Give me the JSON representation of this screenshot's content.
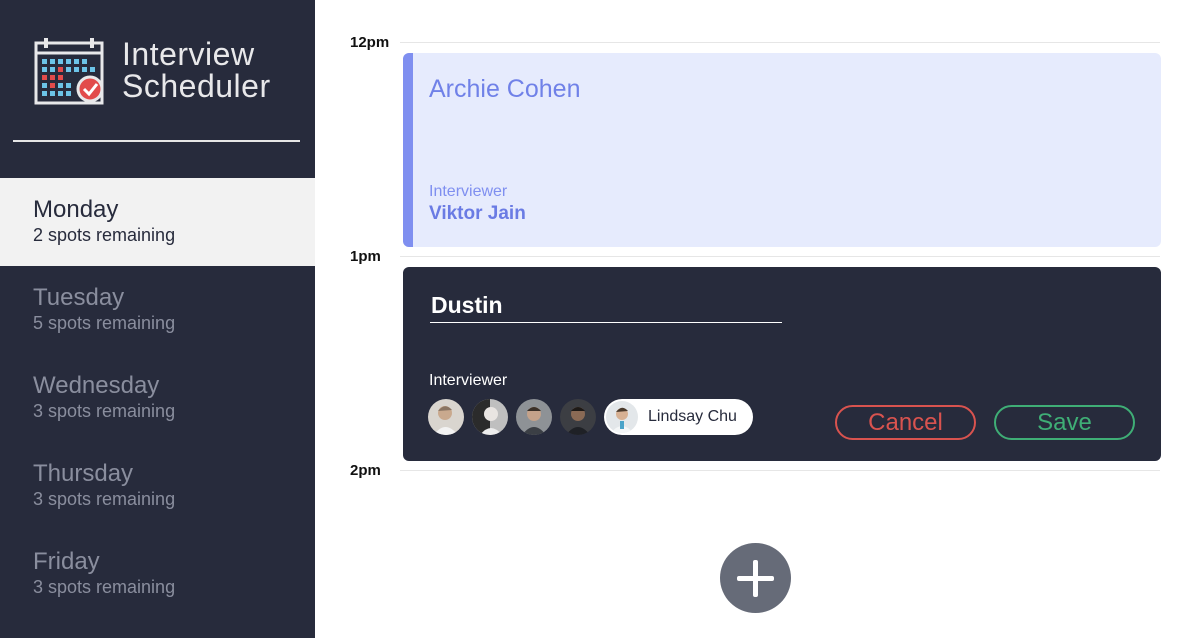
{
  "app": {
    "title_line1": "Interview",
    "title_line2": "Scheduler"
  },
  "days": [
    {
      "name": "Monday",
      "spots": "2 spots remaining",
      "selected": true
    },
    {
      "name": "Tuesday",
      "spots": "5 spots remaining",
      "selected": false
    },
    {
      "name": "Wednesday",
      "spots": "3 spots remaining",
      "selected": false
    },
    {
      "name": "Thursday",
      "spots": "3 spots remaining",
      "selected": false
    },
    {
      "name": "Friday",
      "spots": "3 spots remaining",
      "selected": false
    }
  ],
  "schedule": {
    "hours": [
      "12pm",
      "1pm",
      "2pm"
    ],
    "appointment": {
      "student": "Archie Cohen",
      "interviewer_label": "Interviewer",
      "interviewer": "Viktor Jain"
    },
    "form": {
      "student_value": "Dustin",
      "interviewer_label": "Interviewer",
      "selected_interviewer": "Lindsay Chu",
      "cancel_label": "Cancel",
      "save_label": "Save"
    }
  },
  "colors": {
    "sidebar_bg": "#272b3c",
    "appointment_bg": "#e6ebfd",
    "appointment_accent": "#7f8ff0",
    "cancel": "#d9534f",
    "save": "#3fae76",
    "add_button": "#666b78"
  },
  "icons": {
    "logo": "calendar-check-icon",
    "add": "plus-icon"
  }
}
